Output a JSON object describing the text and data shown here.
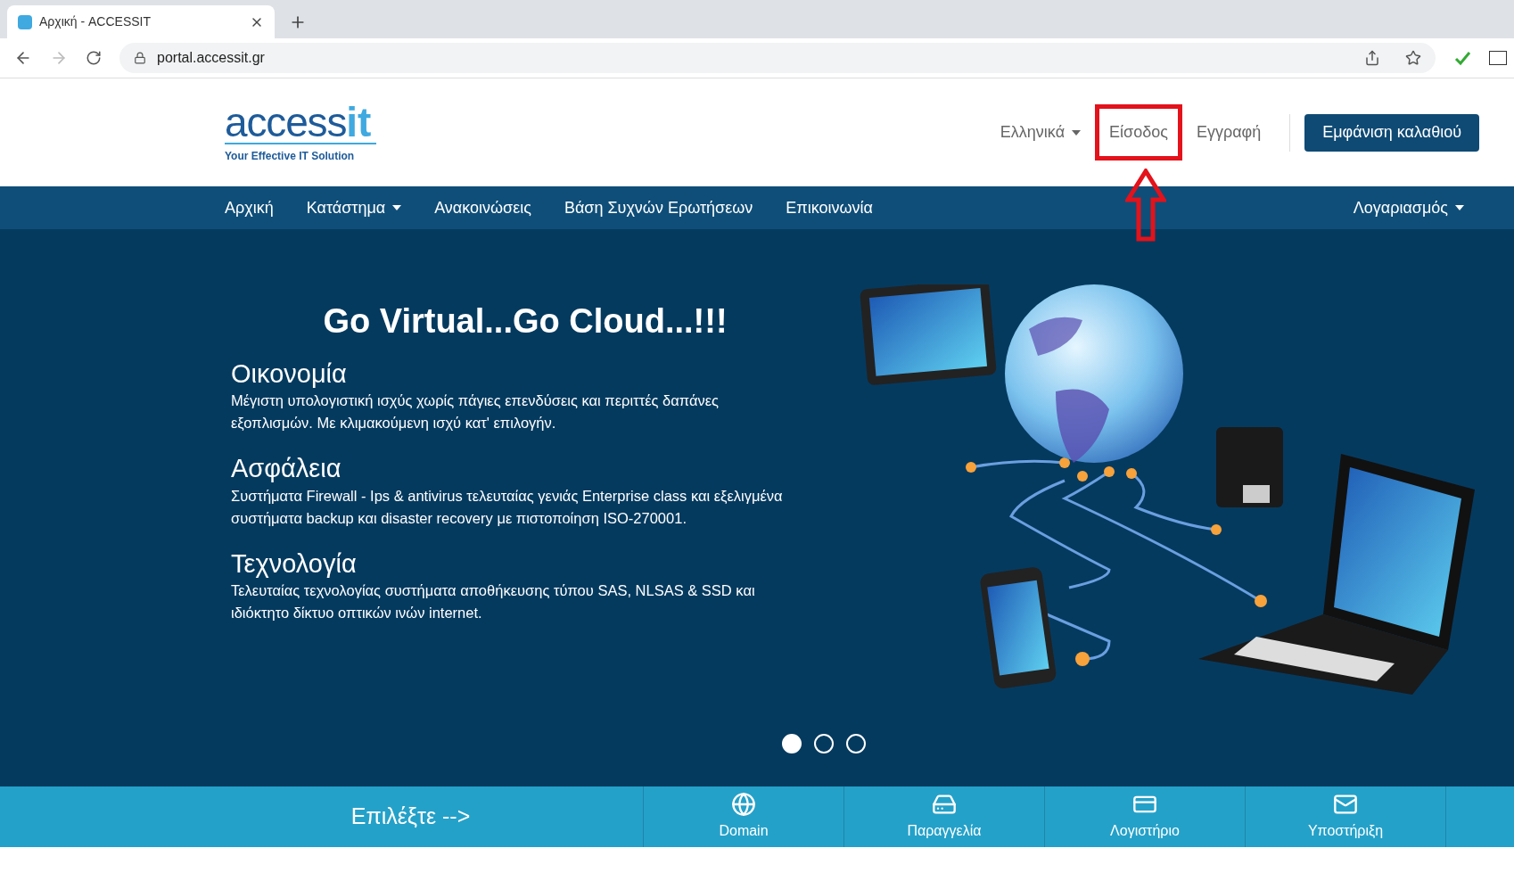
{
  "browser": {
    "tab_title": "Αρχική - ACCESSIT",
    "url": "portal.accessit.gr",
    "forward_disabled": true
  },
  "header": {
    "logo_word": "access",
    "logo_mark": "it",
    "logo_tagline": "Your Effective IT Solution",
    "language": "Ελληνικά",
    "links": [
      {
        "label": "Είσοδος",
        "highlighted": true
      },
      {
        "label": "Εγγραφή",
        "highlighted": false
      }
    ],
    "cart_button": "Εμφάνιση καλαθιού"
  },
  "nav": {
    "items": [
      {
        "label": "Αρχική",
        "dropdown": false
      },
      {
        "label": "Κατάστημα",
        "dropdown": true
      },
      {
        "label": "Ανακοινώσεις",
        "dropdown": false
      },
      {
        "label": "Βάση Συχνών Ερωτήσεων",
        "dropdown": false
      },
      {
        "label": "Επικοινωνία",
        "dropdown": false
      }
    ],
    "account": {
      "label": "Λογαριασμός",
      "dropdown": true
    }
  },
  "hero": {
    "title": "Go Virtual...Go Cloud...!!!",
    "sections": [
      {
        "heading": "Οικονομία",
        "text": "Μέγιστη υπολογιστική ισχύς χωρίς πάγιες επενδύσεις και περιττές δαπάνες εξοπλισμών. Με κλιμακούμενη ισχύ κατ' επιλογήν."
      },
      {
        "heading": "Ασφάλεια",
        "text": "Συστήματα Firewall - Ips & antivirus τελευταίας γενιάς Enterprise class και εξελιγμένα συστήματα backup και disaster recovery με πιστοποίηση ISO-270001."
      },
      {
        "heading": "Τεχνολογία",
        "text": "Τελευταίας τεχνολογίας συστήματα αποθήκευσης τύπου SAS, NLSAS & SSD και ιδιόκτητο δίκτυο οπτικών ινών internet."
      }
    ],
    "slides": [
      {
        "selected": true
      },
      {
        "selected": false
      },
      {
        "selected": false
      }
    ]
  },
  "quick_bar": {
    "prompt": "Επιλέξτε -->",
    "items": [
      {
        "kind": "globe",
        "label": "Domain"
      },
      {
        "kind": "drive",
        "label": "Παραγγελία"
      },
      {
        "kind": "card",
        "label": "Λογιστήριο"
      },
      {
        "kind": "mail",
        "label": "Υποστήριξη"
      }
    ]
  }
}
